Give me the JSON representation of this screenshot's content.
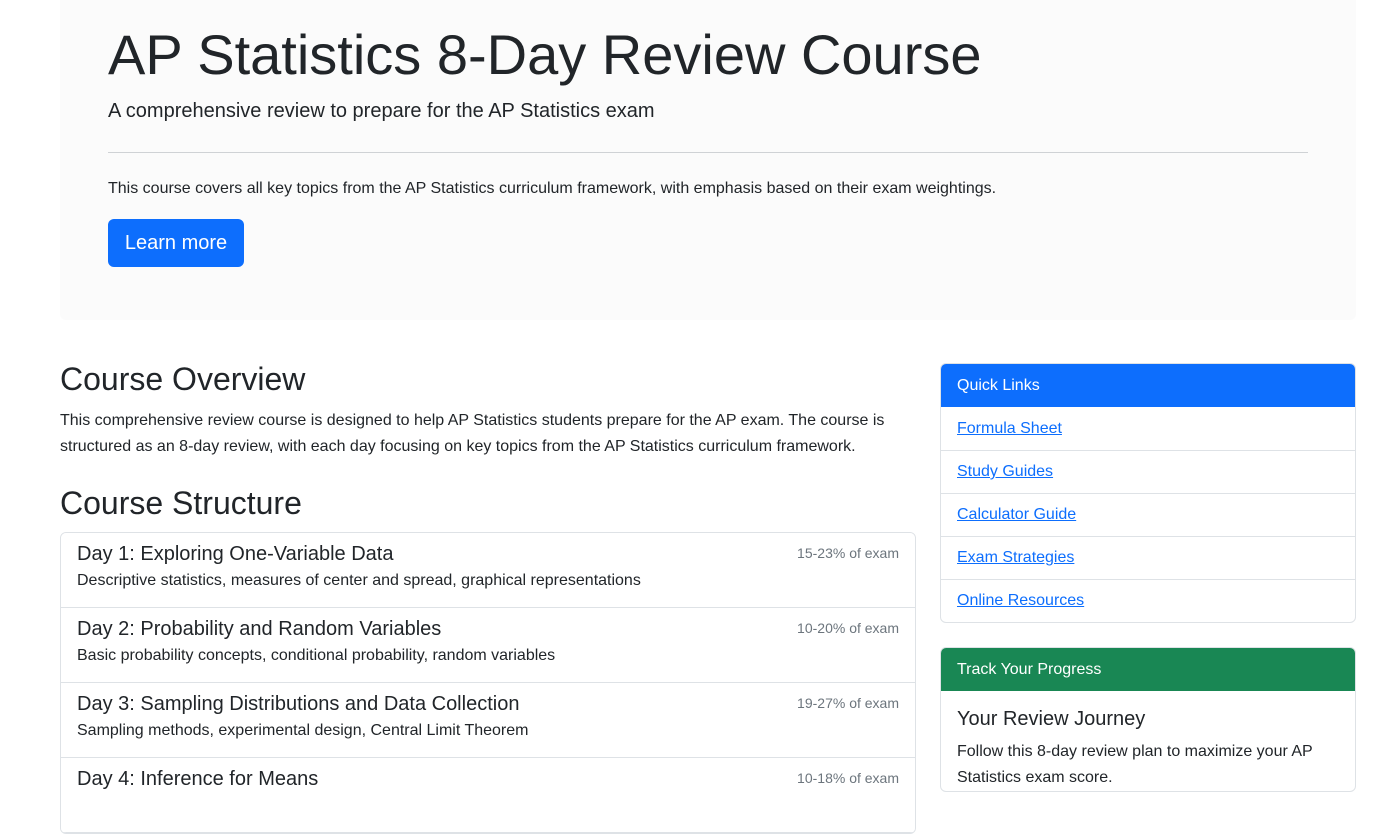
{
  "hero": {
    "title": "AP Statistics 8-Day Review Course",
    "lead": "A comprehensive review to prepare for the AP Statistics exam",
    "description": "This course covers all key topics from the AP Statistics curriculum framework, with emphasis based on their exam weightings.",
    "button_label": "Learn more"
  },
  "overview": {
    "title": "Course Overview",
    "text": "This comprehensive review course is designed to help AP Statistics students prepare for the AP exam. The course is structured as an 8-day review, with each day focusing on key topics from the AP Statistics curriculum framework."
  },
  "structure": {
    "title": "Course Structure",
    "days": [
      {
        "title": "Day 1: Exploring One-Variable Data",
        "weight": "15-23% of exam",
        "desc": "Descriptive statistics, measures of center and spread, graphical representations"
      },
      {
        "title": "Day 2: Probability and Random Variables",
        "weight": "10-20% of exam",
        "desc": "Basic probability concepts, conditional probability, random variables"
      },
      {
        "title": "Day 3: Sampling Distributions and Data Collection",
        "weight": "19-27% of exam",
        "desc": "Sampling methods, experimental design, Central Limit Theorem"
      },
      {
        "title": "Day 4: Inference for Means",
        "weight": "10-18% of exam",
        "desc": ""
      }
    ]
  },
  "quick_links": {
    "header": "Quick Links",
    "items": [
      "Formula Sheet",
      "Study Guides",
      "Calculator Guide",
      "Exam Strategies",
      "Online Resources"
    ]
  },
  "progress": {
    "header": "Track Your Progress",
    "title": "Your Review Journey",
    "text": "Follow this 8-day review plan to maximize your AP Statistics exam score."
  },
  "colors": {
    "primary": "#0d6efd",
    "success": "#198754",
    "hero_bg": "#fbfbfb"
  }
}
